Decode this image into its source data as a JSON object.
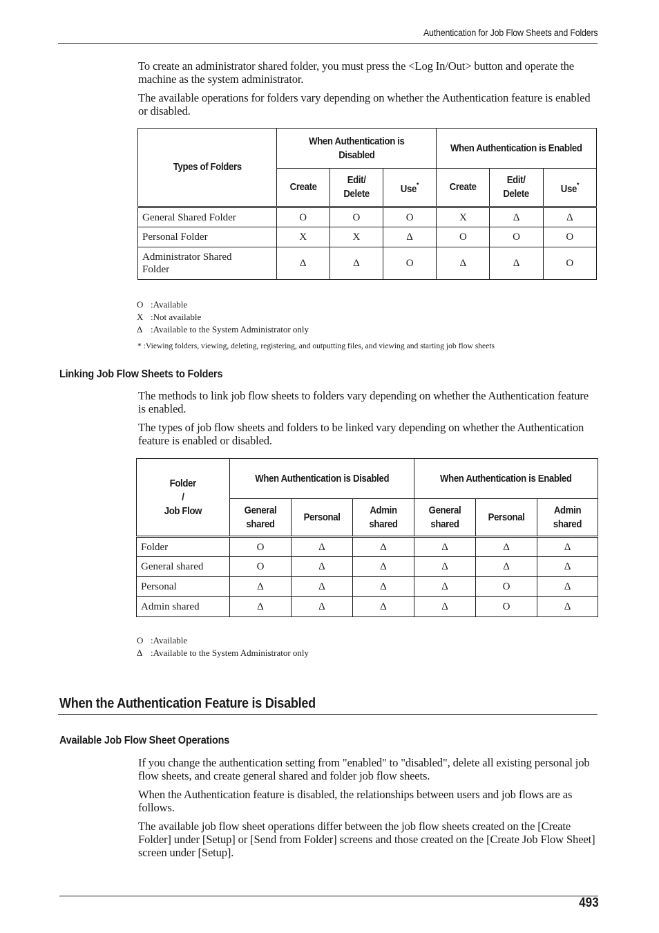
{
  "header": {
    "running_title": "Authentication for Job Flow Sheets and Folders"
  },
  "intro": {
    "para1": "To create an administrator shared folder, you must press the <Log In/Out> button and operate the machine as the system administrator.",
    "para2": "The available operations for folders vary depending on whether the Authentication feature is enabled or disabled."
  },
  "table1": {
    "row_header": "Types of Folders",
    "group_headers": [
      "When Authentication is Disabled",
      "When Authentication is Enabled"
    ],
    "column_headers": [
      "Create",
      "Edit/ Delete",
      "Use",
      "Create",
      "Edit/ Delete",
      "Use"
    ],
    "asterisk": "*",
    "rows": [
      {
        "label": "General Shared Folder",
        "values": [
          "O",
          "O",
          "O",
          "X",
          "Δ",
          "Δ"
        ]
      },
      {
        "label": "Personal Folder",
        "values": [
          "X",
          "X",
          "Δ",
          "O",
          "O",
          "O"
        ]
      },
      {
        "label": "Administrator Shared Folder",
        "values": [
          "Δ",
          "Δ",
          "O",
          "Δ",
          "Δ",
          "O"
        ]
      }
    ]
  },
  "legend1": [
    {
      "symbol": "O",
      "text": ":Available"
    },
    {
      "symbol": "X",
      "text": ":Not available"
    },
    {
      "symbol": "Δ",
      "text": ":Available to the System Administrator only"
    }
  ],
  "footnote1": "* :Viewing folders, viewing, deleting, registering, and outputting files, and viewing and starting job flow sheets",
  "section_linking": {
    "heading": "Linking Job Flow Sheets to Folders",
    "para1": "The methods to link job flow sheets to folders vary depending on whether the Authentication feature is enabled.",
    "para2": "The types of job flow sheets and folders to be linked vary depending on whether the Authentication feature is enabled or disabled."
  },
  "table2": {
    "row_header_lines": [
      "Folder",
      "/",
      "Job Flow"
    ],
    "group_headers": [
      "When Authentication is Disabled",
      "When Authentication is Enabled"
    ],
    "column_headers": [
      "General shared",
      "Personal",
      "Admin shared",
      "General shared",
      "Personal",
      "Admin shared"
    ],
    "rows": [
      {
        "label": "Folder",
        "values": [
          "O",
          "Δ",
          "Δ",
          "Δ",
          "Δ",
          "Δ"
        ]
      },
      {
        "label": "General shared",
        "values": [
          "O",
          "Δ",
          "Δ",
          "Δ",
          "Δ",
          "Δ"
        ]
      },
      {
        "label": "Personal",
        "values": [
          "Δ",
          "Δ",
          "Δ",
          "Δ",
          "O",
          "Δ"
        ]
      },
      {
        "label": "Admin shared",
        "values": [
          "Δ",
          "Δ",
          "Δ",
          "Δ",
          "O",
          "Δ"
        ]
      }
    ]
  },
  "legend2": [
    {
      "symbol": "O",
      "text": ":Available"
    },
    {
      "symbol": "Δ",
      "text": ":Available to the System Administrator only"
    }
  ],
  "section_disabled": {
    "heading": "When the Authentication Feature is Disabled",
    "subheading": "Available Job Flow Sheet Operations",
    "para1": "If you change the authentication setting from \"enabled\" to \"disabled\", delete all existing personal job flow sheets, and create general shared and folder job flow sheets.",
    "para2": "When the Authentication feature is disabled, the relationships between users and job flows are as follows.",
    "para3": "The available job flow sheet operations differ between the job flow sheets created on the [Create Folder] under [Setup] or [Send from Folder] screens and those created on the [Create Job Flow Sheet] screen under [Setup]."
  },
  "footer": {
    "page_number": "493"
  }
}
